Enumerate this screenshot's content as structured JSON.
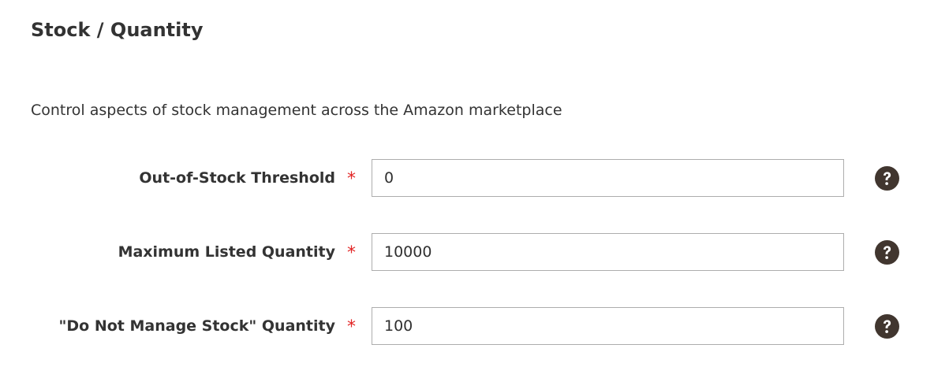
{
  "section": {
    "title": "Stock / Quantity",
    "description": "Control aspects of stock management across the Amazon marketplace"
  },
  "fields": [
    {
      "label": "Out-of-Stock Threshold",
      "required_mark": "*",
      "value": "0",
      "help_icon": "question-circle-icon"
    },
    {
      "label": "Maximum Listed Quantity",
      "required_mark": "*",
      "value": "10000",
      "help_icon": "question-circle-icon"
    },
    {
      "label": "\"Do Not Manage Stock\" Quantity",
      "required_mark": "*",
      "value": "100",
      "help_icon": "question-circle-icon"
    }
  ],
  "colors": {
    "text": "#333333",
    "required": "#e22626",
    "input_border": "#adadad",
    "help_icon": "#41362f"
  }
}
